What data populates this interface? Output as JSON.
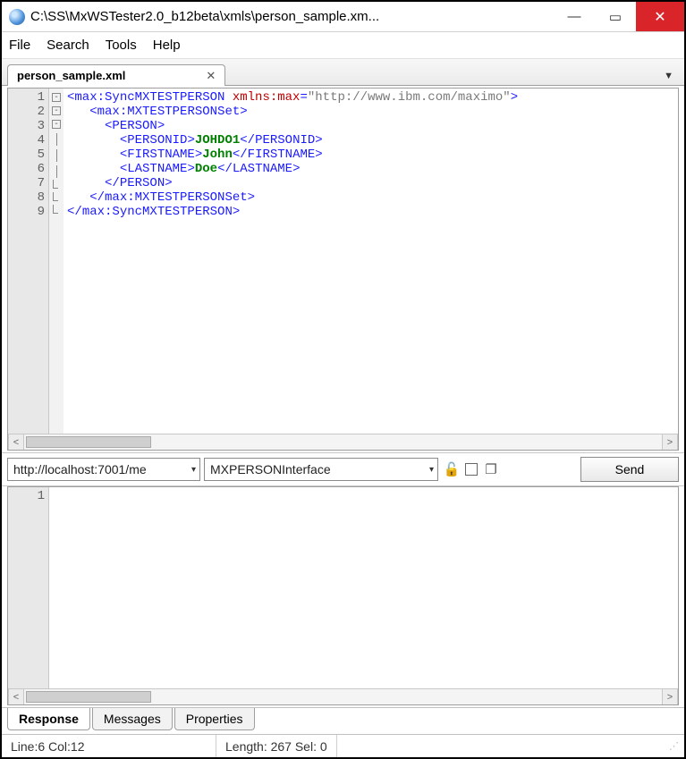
{
  "window": {
    "title": "C:\\SS\\MxWSTester2.0_b12beta\\xmls\\person_sample.xm..."
  },
  "menu": {
    "items": [
      "File",
      "Search",
      "Tools",
      "Help"
    ]
  },
  "tab": {
    "label": "person_sample.xml"
  },
  "code_lines": [
    "1",
    "2",
    "3",
    "4",
    "5",
    "6",
    "7",
    "8",
    "9"
  ],
  "xml": {
    "root_open_a": "max:SyncMXTESTPERSON",
    "root_attr_name": "xmlns:max",
    "root_attr_val": "\"http://www.ibm.com/maximo\"",
    "set_open": "max:MXTESTPERSONSet",
    "person": "PERSON",
    "personid_tag": "PERSONID",
    "personid_val": "JOHDO1",
    "firstname_tag": "FIRSTNAME",
    "firstname_val": "John",
    "lastname_tag": "LASTNAME",
    "lastname_val": "Doe",
    "set_close": "max:MXTESTPERSONSet",
    "root_close": "max:SyncMXTESTPERSON"
  },
  "midbar": {
    "url": "http://localhost:7001/me",
    "iface": "MXPERSONInterface",
    "send": "Send"
  },
  "response_lines": [
    "1"
  ],
  "bottom_tabs": {
    "response": "Response",
    "messages": "Messages",
    "properties": "Properties"
  },
  "status": {
    "line_col": "Line:6  Col:12",
    "length": "Length: 267 Sel: 0"
  }
}
